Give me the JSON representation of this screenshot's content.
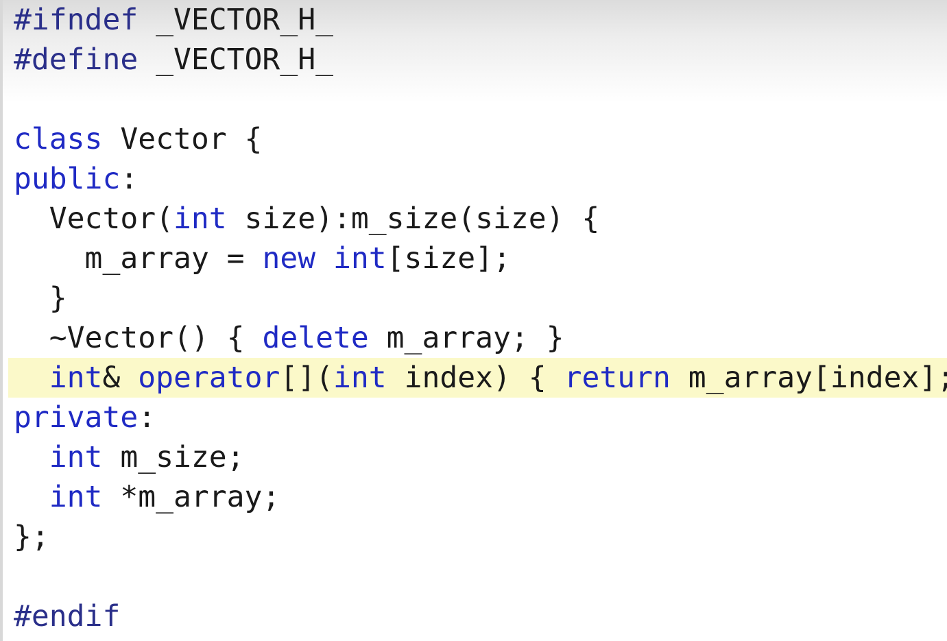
{
  "colors": {
    "keyword": "#1f2ac4",
    "preprocessor": "#2a2f8a",
    "text": "#1a1a1a",
    "highlight_line_bg": "#fbf9c9"
  },
  "highlighted_line": 10,
  "lines": [
    [
      {
        "t": "#ifndef",
        "k": "pp"
      },
      {
        "t": " _VECTOR_H_",
        "k": "plain"
      }
    ],
    [
      {
        "t": "#define",
        "k": "pp"
      },
      {
        "t": " _VECTOR_H_",
        "k": "plain"
      }
    ],
    [],
    [
      {
        "t": "class",
        "k": "kw"
      },
      {
        "t": " Vector {",
        "k": "plain"
      }
    ],
    [
      {
        "t": "public",
        "k": "kw"
      },
      {
        "t": ":",
        "k": "plain"
      }
    ],
    [
      {
        "t": "  Vector(",
        "k": "plain"
      },
      {
        "t": "int",
        "k": "kw"
      },
      {
        "t": " size):m_size(size) {",
        "k": "plain"
      }
    ],
    [
      {
        "t": "    m_array = ",
        "k": "plain"
      },
      {
        "t": "new",
        "k": "kw"
      },
      {
        "t": " ",
        "k": "plain"
      },
      {
        "t": "int",
        "k": "kw"
      },
      {
        "t": "[size];",
        "k": "plain"
      }
    ],
    [
      {
        "t": "  }",
        "k": "plain"
      }
    ],
    [
      {
        "t": "  ~Vector() { ",
        "k": "plain"
      },
      {
        "t": "delete",
        "k": "kw"
      },
      {
        "t": " m_array; }",
        "k": "plain"
      }
    ],
    [
      {
        "t": "  ",
        "k": "plain"
      },
      {
        "t": "int",
        "k": "kw"
      },
      {
        "t": "& ",
        "k": "plain"
      },
      {
        "t": "operator",
        "k": "kw"
      },
      {
        "t": "[](",
        "k": "plain"
      },
      {
        "t": "int",
        "k": "kw"
      },
      {
        "t": " index) { ",
        "k": "plain"
      },
      {
        "t": "return",
        "k": "kw"
      },
      {
        "t": " m_array[index]; }",
        "k": "plain"
      }
    ],
    [
      {
        "t": "private",
        "k": "kw"
      },
      {
        "t": ":",
        "k": "plain"
      }
    ],
    [
      {
        "t": "  ",
        "k": "plain"
      },
      {
        "t": "int",
        "k": "kw"
      },
      {
        "t": " m_size;",
        "k": "plain"
      }
    ],
    [
      {
        "t": "  ",
        "k": "plain"
      },
      {
        "t": "int",
        "k": "kw"
      },
      {
        "t": " *m_array;",
        "k": "plain"
      }
    ],
    [
      {
        "t": "};",
        "k": "plain"
      }
    ],
    [],
    [
      {
        "t": "#endif",
        "k": "pp"
      }
    ]
  ]
}
